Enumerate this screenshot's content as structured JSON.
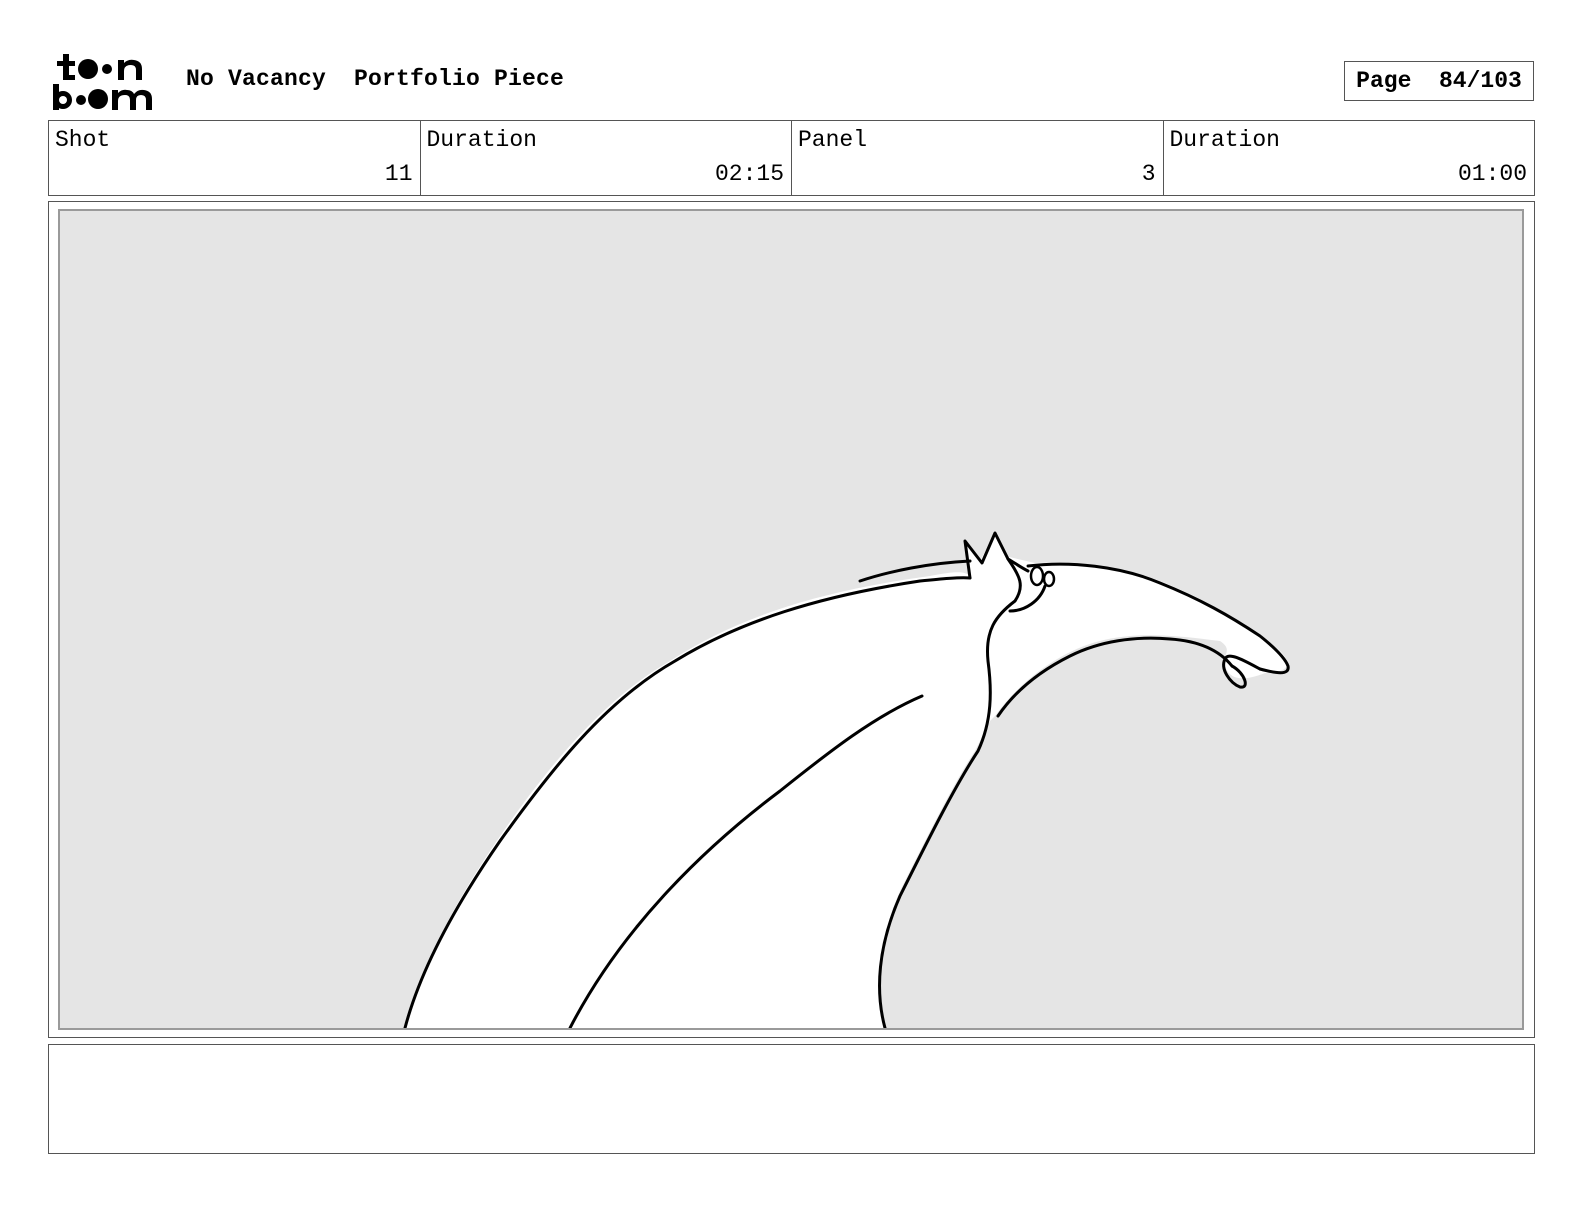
{
  "header": {
    "logo_text_top": "toon",
    "logo_text_bottom": "boom",
    "project_title": "No Vacancy  Portfolio Piece",
    "page_label": "Page  84/103"
  },
  "info": {
    "shot_label": "Shot",
    "shot_value": "11",
    "shot_duration_label": "Duration",
    "shot_duration_value": "02:15",
    "panel_label": "Panel",
    "panel_value": "3",
    "panel_duration_label": "Duration",
    "panel_duration_value": "01:00"
  },
  "panel": {
    "background_color": "#e5e5e5",
    "figure_fill": "#ffffff",
    "line_color": "#000000"
  },
  "notes": {
    "text": ""
  }
}
